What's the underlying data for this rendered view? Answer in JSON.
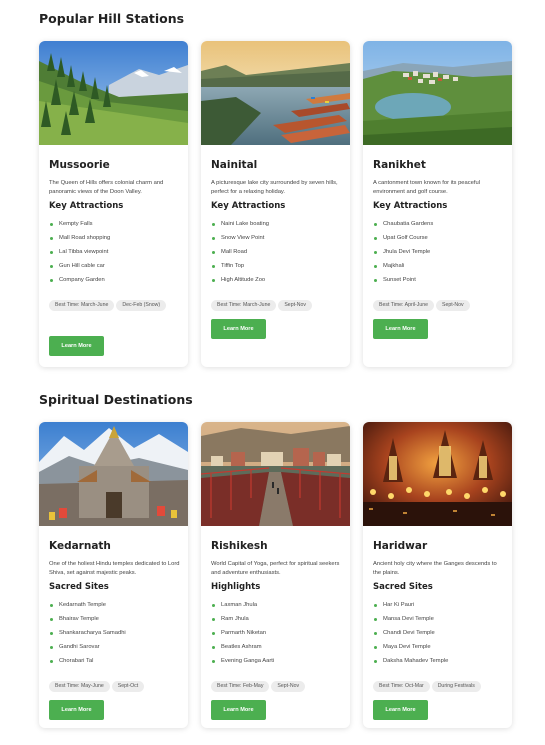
{
  "sections": [
    {
      "title": "Popular Hill Stations",
      "cards": [
        {
          "image": "mountain-valley-photo",
          "name": "Mussoorie",
          "description": "The Queen of Hills offers colonial charm and panoramic views of the Doon Valley.",
          "list_title": "Key Attractions",
          "items": [
            "Kempty Falls",
            "Mall Road shopping",
            "Lal Tibba viewpoint",
            "Gun Hill cable car",
            "Company Garden"
          ],
          "tags": [
            "Best Time: March-June",
            "Dec-Feb (Snow)"
          ],
          "button": "Learn More"
        },
        {
          "image": "lake-boats-photo",
          "name": "Nainital",
          "description": "A picturesque lake city surrounded by seven hills, perfect for a relaxing holiday.",
          "list_title": "Key Attractions",
          "items": [
            "Naini Lake boating",
            "Snow View Point",
            "Mall Road",
            "Tiffin Top",
            "High Altitude Zoo"
          ],
          "tags": [
            "Best Time: March-June",
            "Sept-Nov"
          ],
          "button": "Learn More"
        },
        {
          "image": "hill-town-photo",
          "name": "Ranikhet",
          "description": "A cantonment town known for its peaceful environment and golf course.",
          "list_title": "Key Attractions",
          "items": [
            "Chaubatia Gardens",
            "Upat Golf Course",
            "Jhula Devi Temple",
            "Majkhali",
            "Sunset Point"
          ],
          "tags": [
            "Best Time: April-June",
            "Sept-Nov"
          ],
          "button": "Learn More"
        }
      ]
    },
    {
      "title": "Spiritual Destinations",
      "cards": [
        {
          "image": "mountain-temple-photo",
          "name": "Kedarnath",
          "description": "One of the holiest Hindu temples dedicated to Lord Shiva, set against majestic peaks.",
          "list_title": "Sacred Sites",
          "items": [
            "Kedarnath Temple",
            "Bhairav Temple",
            "Shankaracharya Samadhi",
            "Gandhi Sarovar",
            "Chorabari Tal"
          ],
          "tags": [
            "Best Time: May-June",
            "Sept-Oct"
          ],
          "button": "Learn More"
        },
        {
          "image": "suspension-bridge-photo",
          "name": "Rishikesh",
          "description": "World Capital of Yoga, perfect for spiritual seekers and adventure enthusiasts.",
          "list_title": "Highlights",
          "items": [
            "Laxman Jhula",
            "Ram Jhula",
            "Parmarth Niketan",
            "Beatles Ashram",
            "Evening Ganga Aarti"
          ],
          "tags": [
            "Best Time: Feb-May",
            "Sept-Nov"
          ],
          "button": "Learn More"
        },
        {
          "image": "ganga-aarti-photo",
          "name": "Haridwar",
          "description": "Ancient holy city where the Ganges descends to the plains.",
          "list_title": "Sacred Sites",
          "items": [
            "Har Ki Pauri",
            "Mansa Devi Temple",
            "Chandi Devi Temple",
            "Maya Devi Temple",
            "Daksha Mahadev Temple"
          ],
          "tags": [
            "Best Time: Oct-Mar",
            "During Festivals"
          ],
          "button": "Learn More"
        }
      ]
    }
  ],
  "colors": {
    "accent": "#4caf50",
    "tag_bg": "#ececec",
    "heading": "#222222"
  }
}
